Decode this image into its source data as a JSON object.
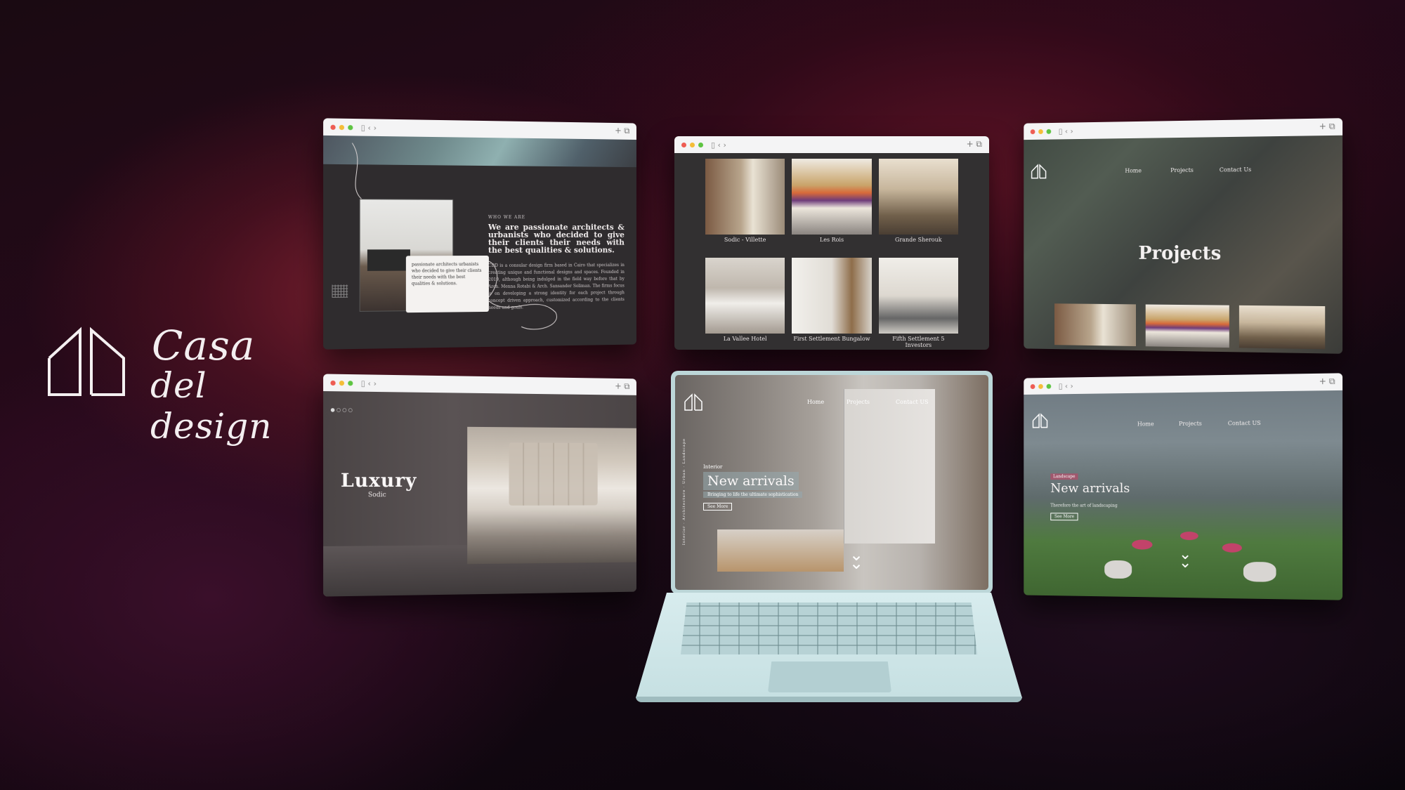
{
  "brand": {
    "line1": "Casa",
    "line2": "del design"
  },
  "panel_about": {
    "heading_small": "WHO WE ARE",
    "heading": "We are passionate architects & urbanists who decided to give their clients their needs with the best qualities & solutions.",
    "paragraph": "CDD is a consular design firm based in Cairo that specializes in creating unique and functional designs and spaces. Founded in 2019, although being indulged in the field way before that by Arch. Menna Rotabi & Arch. Sansander Soliman. The firms focus is on developing a strong identity for each project through concept driven approach, customized according to the clients needs and goals.",
    "note": "passionate architects urbanists who decided to give their clients their needs with the best qualities & solutions."
  },
  "panel_gallery": {
    "tiles": [
      {
        "caption": "Sodic - Villette"
      },
      {
        "caption": "Les Rois"
      },
      {
        "caption": "Grande Sherouk"
      },
      {
        "caption": "La Vallee Hotel"
      },
      {
        "caption": "First Settlement Bungalow"
      },
      {
        "caption": "Fifth Settlement 5 Investors"
      }
    ]
  },
  "panel_projects": {
    "nav": [
      "Home",
      "Projects",
      "Contact Us"
    ],
    "title": "Projects"
  },
  "panel_luxury": {
    "title": "Luxury",
    "subtitle": "Sodic"
  },
  "laptop": {
    "nav": [
      "Home",
      "Projects",
      "Contact US"
    ],
    "side": "Interior · Architecture · Urban · Landscape",
    "kicker": "Interior",
    "headline": "New arrivals",
    "subline": "Bringing to life the ultimate sophistication",
    "cta": "See More"
  },
  "panel_landscape": {
    "nav": [
      "Home",
      "Projects",
      "Contact US"
    ],
    "tag": "Landscape",
    "headline": "New arrivals",
    "subline": "Therefore the art of landscaping",
    "cta": "See More"
  },
  "icons": [
    "house-logo-icon",
    "traffic-light-icon",
    "tabs-icon",
    "chevron-down-icon"
  ]
}
